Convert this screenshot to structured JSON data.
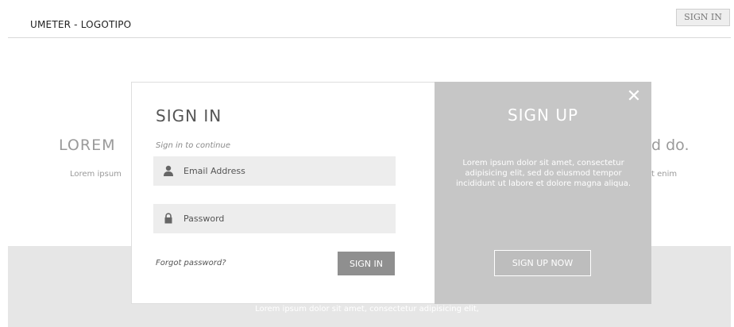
{
  "header": {
    "logo": "UMETER - LOGOTIPO",
    "signin_button": "SIGN IN"
  },
  "background": {
    "heading_left": "LOREM",
    "heading_right": "d do.",
    "text_left": "Lorem ipsum",
    "text_right": "t enim",
    "band_text": "Lorem ipsum dolor sit amet, consectetur adipisicing elit,"
  },
  "signin": {
    "title": "SIGN IN",
    "subtitle": "Sign in to continue",
    "email_placeholder": "Email Address",
    "password_placeholder": "Password",
    "forgot_link": "Forgot password?",
    "submit_label": "SIGN IN",
    "icons": {
      "email": "user-icon",
      "password": "lock-icon"
    }
  },
  "signup": {
    "title": "SIGN UP",
    "text": "Lorem ipsum dolor sit amet, consectetur adipisicing elit, sed do eiusmod tempor incididunt ut labore et dolore magna aliqua.",
    "button_label": "SIGN UP NOW",
    "close_glyph": "✕"
  },
  "colors": {
    "signup_panel": "#c6c6c6",
    "field_bg": "#ededed",
    "signin_button_bg": "#8f8f8f",
    "band_bg": "#e6e6e6"
  }
}
